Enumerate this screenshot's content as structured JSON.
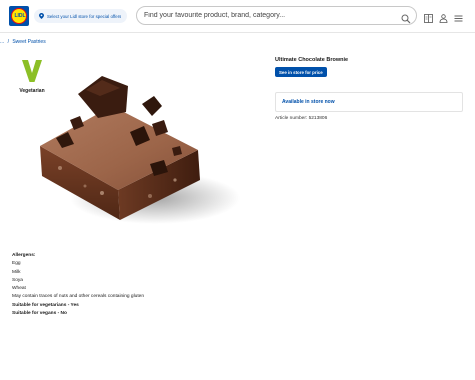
{
  "header": {
    "logo_text": "LIDL",
    "store_prompt": "Select your Lidl store for special offers",
    "search_placeholder": "Find your favourite product, brand, category...",
    "icons": [
      "search-icon",
      "leaflet-icon",
      "user-icon",
      "menu-icon"
    ]
  },
  "breadcrumb": {
    "ellipsis": "...",
    "separator": "/",
    "current": "Sweet Pastries"
  },
  "badge": {
    "letter": "V",
    "label": "Vegetarian",
    "color": "#8cbf26"
  },
  "product": {
    "title": "Ultimate Chocolate Brownie",
    "price_button": "See in store for price",
    "availability": "Available in store now",
    "article_number": "Article number: 5213806"
  },
  "allergens": {
    "heading": "Allergens:",
    "items": [
      "Egg",
      "Milk",
      "Soya",
      "Wheat"
    ],
    "trace_note": "May contain traces of nuts and other cereals containing gluten",
    "vegetarian": "Suitable for vegetarians - Yes",
    "vegan": "Suitable for vegans - No"
  },
  "colors": {
    "brand_blue": "#0050aa",
    "brand_yellow": "#ffe500",
    "brand_red": "#e60a14"
  }
}
